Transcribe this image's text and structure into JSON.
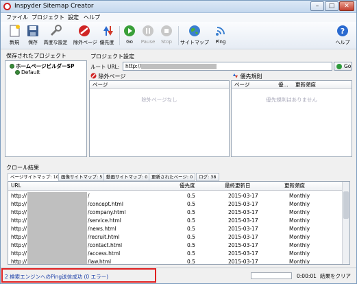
{
  "window": {
    "title": "Inspyder Sitemap Creator",
    "minimize": "–",
    "maximize": "□",
    "close": "✕"
  },
  "menu": [
    "ファイル",
    "プロジェクト",
    "設定",
    "ヘルプ"
  ],
  "toolbar": {
    "new": "新規",
    "save": "保存",
    "advanced": "高度な設定",
    "exclude_pages": "除外ページ",
    "priority": "優先度",
    "go": "Go",
    "pause": "Pause",
    "stop": "Stop",
    "sitemap": "サイトマップ",
    "ping": "Ping",
    "help": "ヘルプ"
  },
  "saved_projects": {
    "title": "保存されたプロジェクト",
    "items": [
      {
        "label": "ホームページビルダーSP",
        "selected": true
      },
      {
        "label": "Default",
        "selected": false
      }
    ]
  },
  "project_settings": {
    "title": "プロジェクト設定",
    "root_url_label": "ルート URL:",
    "root_url_value": "http://",
    "go_button": "Go"
  },
  "exclude_pages": {
    "title": "除外ページ",
    "column": "ページ",
    "empty": "除外ページなし"
  },
  "priority_rules": {
    "title": "優先規則",
    "columns": [
      "ページ",
      "優...",
      "更新頻度"
    ],
    "empty": "優先規則はありません"
  },
  "crawl_results": {
    "title": "クロール結果",
    "tabs": [
      "ページサイトマップ: 10",
      "画像サイトマップ: 5",
      "動画サイトマップ: 0",
      "更新されたページ: 0",
      "ログ: 38"
    ],
    "columns": [
      "URL",
      "優先度",
      "最終更新日",
      "更新頻度"
    ],
    "rows": [
      {
        "url": "http://",
        "path": "/",
        "priority": "0.5",
        "date": "2015-03-17",
        "freq": "Monthly"
      },
      {
        "url": "http://",
        "path": "/concept.html",
        "priority": "0.5",
        "date": "2015-03-17",
        "freq": "Monthly"
      },
      {
        "url": "http://",
        "path": "/company.html",
        "priority": "0.5",
        "date": "2015-03-17",
        "freq": "Monthly"
      },
      {
        "url": "http://",
        "path": "/service.html",
        "priority": "0.5",
        "date": "2015-03-17",
        "freq": "Monthly"
      },
      {
        "url": "http://",
        "path": "/news.html",
        "priority": "0.5",
        "date": "2015-03-17",
        "freq": "Monthly"
      },
      {
        "url": "http://",
        "path": "/recruit.html",
        "priority": "0.5",
        "date": "2015-03-17",
        "freq": "Monthly"
      },
      {
        "url": "http://",
        "path": "/contact.html",
        "priority": "0.5",
        "date": "2015-03-17",
        "freq": "Monthly"
      },
      {
        "url": "http://",
        "path": "/access.html",
        "priority": "0.5",
        "date": "2015-03-17",
        "freq": "Monthly"
      },
      {
        "url": "http://",
        "path": "/law.html",
        "priority": "0.5",
        "date": "2015-03-17",
        "freq": "Monthly"
      }
    ]
  },
  "status": {
    "message": "2 検索エンジンへのPing送信成功 (0 エラー)",
    "elapsed": "0:00:01",
    "clear": "結果をクリア"
  }
}
